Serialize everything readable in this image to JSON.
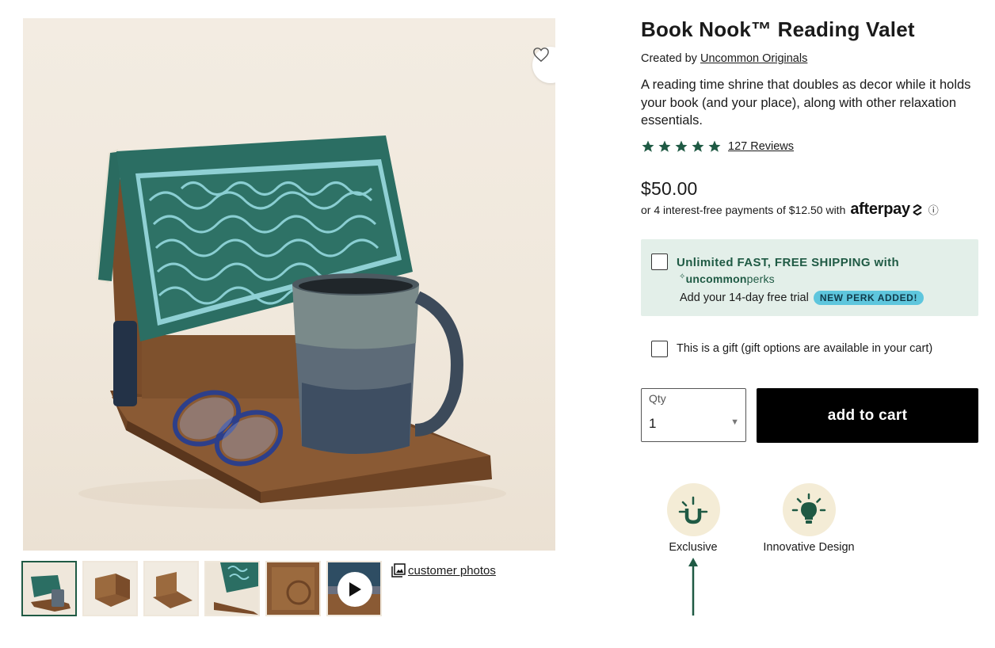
{
  "product": {
    "title": "Book Nook™ Reading Valet",
    "created_by_prefix": "Created by",
    "creator": "Uncommon Originals",
    "description": "A reading time shrine that doubles as decor while it holds your book (and your place), along with other relaxation essentials.",
    "rating_stars": 5,
    "reviews_label": "127 Reviews",
    "price": "$50.00",
    "installments_text": "or 4 interest-free payments of $12.50 with",
    "afterpay_logo": "afterpay",
    "info_icon": "ⓘ"
  },
  "perks": {
    "headline": "Unlimited FAST, FREE SHIPPING with",
    "brand_bold": "uncommon",
    "brand_light": "perks",
    "trial_text": "Add your 14-day free trial",
    "badge": "NEW PERK ADDED!"
  },
  "gift": {
    "label": "This is a gift (gift options are available in your cart)"
  },
  "purchase": {
    "qty_label": "Qty",
    "qty_value": "1",
    "add_to_cart": "add to cart"
  },
  "features": [
    {
      "label": "Exclusive",
      "icon": "exclusive-u-icon"
    },
    {
      "label": "Innovative Design",
      "icon": "lightbulb-icon"
    }
  ],
  "gallery": {
    "customer_photos": "customer photos",
    "thumbnail_count": 6
  },
  "colors": {
    "brand_green": "#1f5a44",
    "perks_bg": "#e3efe9",
    "badge_bg": "#5ec6dd",
    "cta_bg": "#000000",
    "feature_circle": "#f4ecd6"
  }
}
